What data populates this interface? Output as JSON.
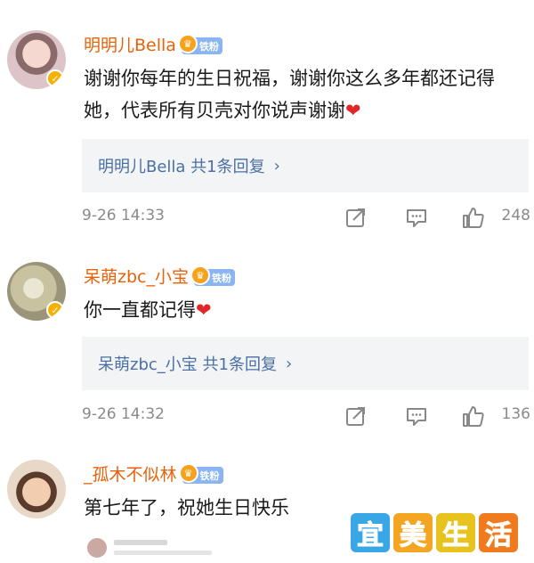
{
  "comments": [
    {
      "username": "明明儿Bella",
      "badge": "铁粉",
      "text": "谢谢你每年的生日祝福，谢谢你这么多年都还记得她，代表所有贝壳对你说声谢谢",
      "heart": "❤",
      "reply_summary": "明明儿Bella  共1条回复",
      "reply_chevron": "›",
      "timestamp": "9-26 14:33",
      "likes": "248"
    },
    {
      "username": "呆萌zbc_小宝",
      "badge": "铁粉",
      "text": "你一直都记得",
      "heart": "❤",
      "reply_summary": "呆萌zbc_小宝  共1条回复",
      "reply_chevron": "›",
      "timestamp": "9-26 14:32",
      "likes": "136"
    },
    {
      "username": "_孤木不似林",
      "badge": "铁粉",
      "text": "第七年了，祝她生日快乐"
    }
  ],
  "watermark": {
    "chars": [
      "宜",
      "美",
      "生",
      "活"
    ],
    "colors": [
      "#39a6e6",
      "#f4a623",
      "#e8c21d",
      "#f07b1e"
    ]
  },
  "icons": {
    "verified": "verified-badge-icon",
    "crown": "fan-crown-icon",
    "share": "share-icon",
    "comment": "comment-icon",
    "like": "like-icon"
  }
}
